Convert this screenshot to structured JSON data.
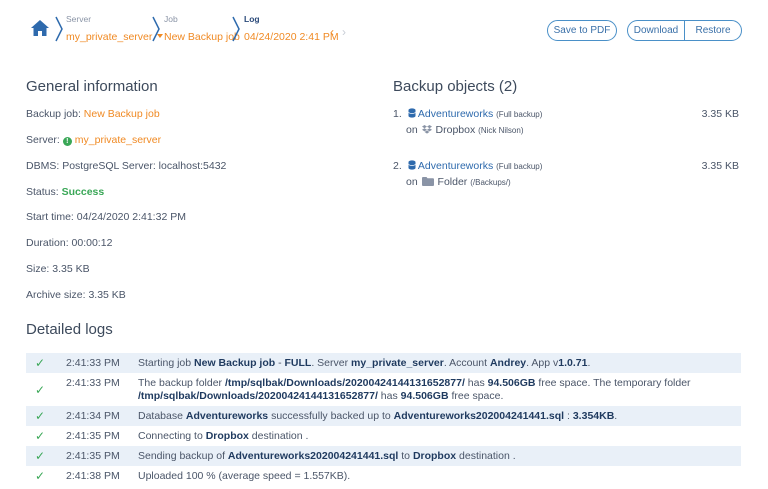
{
  "breadcrumb": {
    "server": {
      "label": "Server",
      "value": "my_private_server"
    },
    "job": {
      "label": "Job",
      "value": "New Backup job"
    },
    "log": {
      "label": "Log",
      "value": "04/24/2020 2:41 PM"
    }
  },
  "toolbar": {
    "save_pdf": "Save to PDF",
    "download": "Download",
    "restore": "Restore"
  },
  "general": {
    "title": "General information",
    "backup_job_label": "Backup job:",
    "backup_job_value": "New Backup job",
    "server_label": "Server:",
    "server_value": "my_private_server",
    "dbms_label": "DBMS:",
    "dbms_value": "PostgreSQL Server: localhost:5432",
    "status_label": "Status:",
    "status_value": "Success",
    "start_time_label": "Start time:",
    "start_time_value": "04/24/2020 2:41:32 PM",
    "duration_label": "Duration:",
    "duration_value": "00:00:12",
    "size_label": "Size:",
    "size_value": "3.35 KB",
    "archive_size_label": "Archive size:",
    "archive_size_value": "3.35 KB"
  },
  "objects": {
    "title": "Backup objects (2)",
    "items": [
      {
        "num": "1.",
        "name": "Adventureworks",
        "type": "(Full backup)",
        "on": "on",
        "dest": "Dropbox",
        "dest_note": "(Nick Nilson)",
        "size": "3.35 KB"
      },
      {
        "num": "2.",
        "name": "Adventureworks",
        "type": "(Full backup)",
        "on": "on",
        "dest": "Folder",
        "dest_note": "(/Backups/)",
        "size": "3.35 KB"
      }
    ]
  },
  "logs": {
    "title": "Detailed logs",
    "rows": [
      {
        "time": "2:41:33 PM",
        "parts": [
          [
            "Starting job ",
            false
          ],
          [
            "New Backup job",
            true
          ],
          [
            " - ",
            false
          ],
          [
            "FULL",
            true
          ],
          [
            ". Server ",
            false
          ],
          [
            "my_private_server",
            true
          ],
          [
            ". Account ",
            false
          ],
          [
            "Andrey",
            true
          ],
          [
            ". App v",
            false
          ],
          [
            "1.0.71",
            true
          ],
          [
            ".",
            false
          ]
        ]
      },
      {
        "time": "2:41:33 PM",
        "parts": [
          [
            "The backup folder ",
            false
          ],
          [
            "/tmp/sqlbak/Downloads/20200424144131652877/",
            true
          ],
          [
            " has ",
            false
          ],
          [
            "94.506GB",
            true
          ],
          [
            " free space. The temporary folder ",
            false
          ],
          [
            "/tmp/sqlbak/Downloads/20200424144131652877/",
            true
          ],
          [
            " has ",
            false
          ],
          [
            "94.506GB",
            true
          ],
          [
            " free space.",
            false
          ]
        ]
      },
      {
        "time": "2:41:34 PM",
        "parts": [
          [
            "Database ",
            false
          ],
          [
            "Adventureworks",
            true
          ],
          [
            " successfully backed up to ",
            false
          ],
          [
            "Adventureworks202004241441.sql",
            true
          ],
          [
            " : ",
            false
          ],
          [
            "3.354KB",
            true
          ],
          [
            ".",
            false
          ]
        ]
      },
      {
        "time": "2:41:35 PM",
        "parts": [
          [
            "Connecting to ",
            false
          ],
          [
            "Dropbox",
            true
          ],
          [
            " destination .",
            false
          ]
        ]
      },
      {
        "time": "2:41:35 PM",
        "parts": [
          [
            "Sending backup of ",
            false
          ],
          [
            "Adventureworks202004241441.sql",
            true
          ],
          [
            " to ",
            false
          ],
          [
            "Dropbox",
            true
          ],
          [
            " destination .",
            false
          ]
        ]
      },
      {
        "time": "2:41:38 PM",
        "parts": [
          [
            "Uploaded 100 % (average speed = 1.557KB).",
            false
          ]
        ]
      }
    ]
  },
  "colors": {
    "accent_orange": "#f08a24",
    "link_blue": "#2e6aad",
    "success_green": "#3aa757",
    "row_shade": "#e9f0f8"
  }
}
